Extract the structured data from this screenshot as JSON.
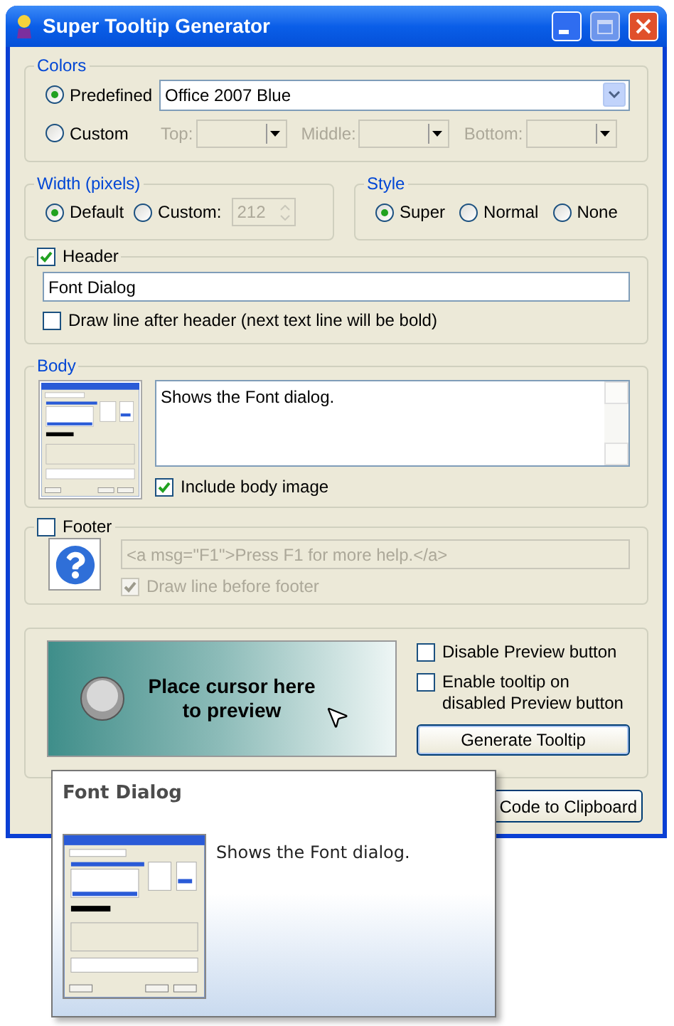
{
  "window": {
    "title": "Super Tooltip Generator"
  },
  "colors": {
    "legend": "Colors",
    "options": [
      {
        "label": "Predefined",
        "selected": true
      },
      {
        "label": "Custom",
        "selected": false
      }
    ],
    "predefined_value": "Office 2007 Blue",
    "custom_selects": [
      {
        "label": "Top:",
        "disabled": true
      },
      {
        "label": "Middle:",
        "disabled": true
      },
      {
        "label": "Bottom:",
        "disabled": true
      }
    ]
  },
  "width": {
    "legend": "Width (pixels)",
    "options": [
      {
        "label": "Default",
        "selected": true
      },
      {
        "label": "Custom:",
        "selected": false
      }
    ],
    "custom_value": "212",
    "custom_disabled": true
  },
  "style": {
    "legend": "Style",
    "options": [
      {
        "label": "Super",
        "selected": true
      },
      {
        "label": "Normal",
        "selected": false
      },
      {
        "label": "None",
        "selected": false
      }
    ]
  },
  "header": {
    "label": "Header",
    "checked": true,
    "value": "Font Dialog",
    "draw_line": {
      "label": "Draw line after header (next text line will be bold)",
      "checked": false
    }
  },
  "body": {
    "legend": "Body",
    "text": "Shows the Font dialog.",
    "include_image": {
      "label": "Include body image",
      "checked": true
    }
  },
  "footer": {
    "label": "Footer",
    "checked": false,
    "value": "<a msg=\"F1\">Press F1 for more help.</a>",
    "disabled": true,
    "draw_line": {
      "label": "Draw line before footer",
      "checked": true,
      "disabled": true
    }
  },
  "preview": {
    "text": "Place cursor here to preview",
    "options": [
      {
        "label": "Disable Preview button",
        "checked": false
      },
      {
        "label": "Enable tooltip on disabled Preview button",
        "checked": false
      }
    ],
    "generate_button": "Generate Tooltip"
  },
  "copy_button": "Code to Clipboard",
  "tooltip": {
    "title": "Font Dialog",
    "text": "Shows the Font dialog."
  }
}
